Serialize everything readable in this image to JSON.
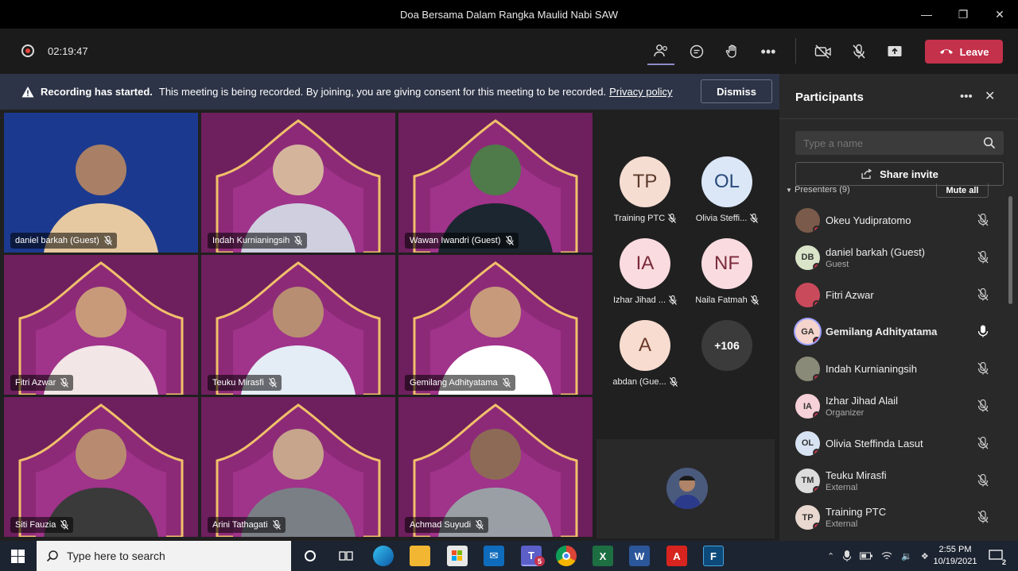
{
  "window": {
    "title": "Doa Bersama Dalam Rangka Maulid Nabi SAW"
  },
  "toolbar": {
    "timer": "02:19:47",
    "leave_label": "Leave"
  },
  "banner": {
    "bold": "Recording has started.",
    "message": "This meeting is being recorded. By joining, you are giving consent for this meeting to be recorded.",
    "link": "Privacy policy",
    "dismiss": "Dismiss"
  },
  "tiles": [
    {
      "name": "daniel barkah (Guest)"
    },
    {
      "name": "Indah Kurnianingsih"
    },
    {
      "name": "Wawan Iwandri (Guest)"
    },
    {
      "name": "Fitri Azwar"
    },
    {
      "name": "Teuku Mirasfi"
    },
    {
      "name": "Gemilang Adhityatama"
    },
    {
      "name": "Siti Fauzia"
    },
    {
      "name": "Arini Tathagati"
    },
    {
      "name": "Achmad Suyudi"
    }
  ],
  "audio_participants": [
    {
      "initials": "TP",
      "label": "Training PTC"
    },
    {
      "initials": "OL",
      "label": "Olivia Steffi..."
    },
    {
      "initials": "IA",
      "label": "Izhar Jihad ..."
    },
    {
      "initials": "NF",
      "label": "Naila Fatmah"
    },
    {
      "initials": "A",
      "label": "abdan (Gue..."
    }
  ],
  "overflow_count": "+106",
  "panel": {
    "title": "Participants",
    "search_placeholder": "Type a name",
    "share_invite": "Share invite",
    "presenters_header": "Presenters (9)",
    "mute_all": "Mute all",
    "people": [
      {
        "initials": "",
        "name": "Okeu Yudipratomo",
        "sub": ""
      },
      {
        "initials": "DB",
        "name": "daniel barkah (Guest)",
        "sub": "Guest"
      },
      {
        "initials": "",
        "name": "Fitri Azwar",
        "sub": ""
      },
      {
        "initials": "GA",
        "name": "Gemilang Adhityatama",
        "sub": ""
      },
      {
        "initials": "",
        "name": "Indah Kurnianingsih",
        "sub": ""
      },
      {
        "initials": "IA",
        "name": "Izhar Jihad Alail",
        "sub": "Organizer"
      },
      {
        "initials": "OL",
        "name": "Olivia Steffinda Lasut",
        "sub": ""
      },
      {
        "initials": "TM",
        "name": "Teuku Mirasfi",
        "sub": "External"
      },
      {
        "initials": "TP",
        "name": "Training PTC",
        "sub": "External"
      }
    ]
  },
  "taskbar": {
    "search_placeholder": "Type here to search",
    "time": "2:55 PM",
    "date": "10/19/2021",
    "teams_badge": "5",
    "notif_count": "2"
  }
}
